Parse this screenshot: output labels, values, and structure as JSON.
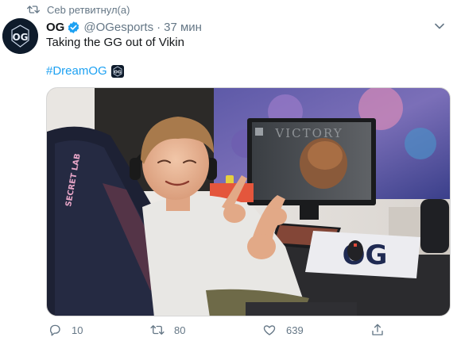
{
  "retweet_banner": {
    "text": "Ceb ретвитнул(а)",
    "icon": "retweet-icon"
  },
  "author": {
    "avatar_text": "OG",
    "name": "OG",
    "verified": true,
    "handle": "@OGesports",
    "separator": "·",
    "time": "37 мин"
  },
  "tweet": {
    "text": "Taking the GG out of Vikin",
    "hashtag": "#DreamOG",
    "hashflag_text": "OG"
  },
  "media": {
    "monitor_text": "VICTORY",
    "chair_brand": "SECRET LAB",
    "mousepad_text": "OG"
  },
  "actions": {
    "reply_count": "10",
    "retweet_count": "80",
    "like_count": "639"
  },
  "colors": {
    "accent": "#1da1f2",
    "secondary_text": "#657786",
    "primary_text": "#14171a",
    "og_navy": "#0e1b2b"
  }
}
